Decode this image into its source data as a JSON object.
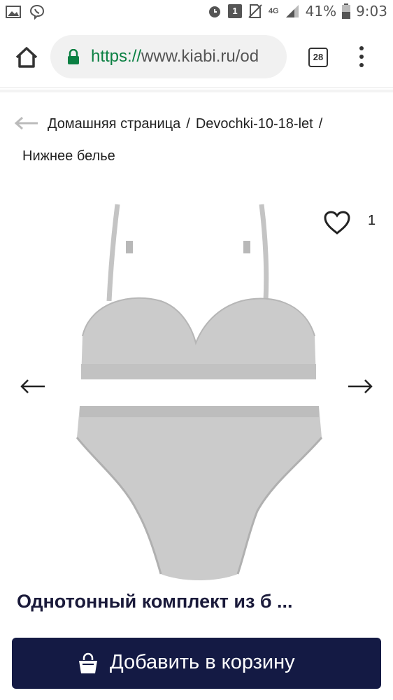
{
  "status_bar": {
    "battery_percent": "41%",
    "time": "9:03",
    "notification_count": "1",
    "network": "4G"
  },
  "browser": {
    "url_scheme": "https://",
    "url_host": "www.kiabi.ru/od",
    "tab_count": "28"
  },
  "breadcrumb": {
    "items": [
      "Домашняя страница",
      "Devochki-10-18-let",
      "Нижнее белье"
    ],
    "separator": "/"
  },
  "product": {
    "favorites_count": "1",
    "title": "Однотонный комплект из б ..."
  },
  "cart": {
    "label": "Добавить в корзину"
  },
  "colors": {
    "url_green": "#0b8043",
    "cart_button_bg": "#141a44",
    "product_gray": "#c8c8c8"
  }
}
